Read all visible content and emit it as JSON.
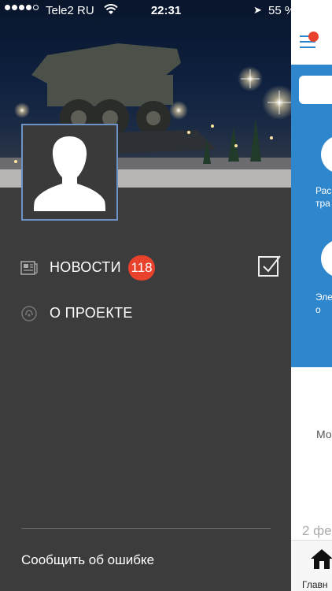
{
  "status_bar": {
    "carrier": "Tele2 RU",
    "time": "22:31",
    "battery_percent": "55 %",
    "battery_level": 0.55,
    "signal_bars": 4,
    "signal_total": 5
  },
  "drawer": {
    "menu": [
      {
        "label": "НОВОСТИ",
        "icon": "newspaper-icon",
        "badge": "118"
      },
      {
        "label": "О ПРОЕКТЕ",
        "icon": "info-icon"
      }
    ],
    "report_error": "Сообщить об ошибке"
  },
  "main": {
    "tiles": [
      {
        "label": "Рас\nтра"
      },
      {
        "label": "Эле\nо"
      }
    ],
    "partial_text": "Мо",
    "date_partial": "2 фе",
    "tab_home_label": "Главн"
  },
  "colors": {
    "drawer_bg": "#3c3c3c",
    "badge": "#e8412c",
    "accent_blue": "#2e86cc",
    "avatar_border": "#6e93c6"
  }
}
